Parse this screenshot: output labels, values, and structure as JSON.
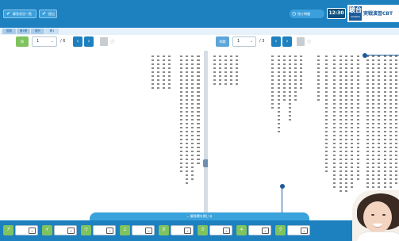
{
  "header": {
    "btn_exit": "解答状況一覧",
    "btn_submit": "提出",
    "timer_label": "残り時間",
    "timer_value": "12:30",
    "logo_main": "駿台",
    "logo_sub": "SUNDAI",
    "brand": "実戦演習CBT"
  },
  "breadcrumbs": [
    "国語",
    "第1問",
    "現代",
    "問1"
  ],
  "left_doc": {
    "score": "問",
    "page": "1",
    "total": "/ 6"
  },
  "right_doc": {
    "score": "問題",
    "page": "1",
    "total": "/ 3"
  },
  "toggle_label": "解答欄を閉じる",
  "answers": [
    {
      "q": "ア"
    },
    {
      "q": "イ"
    },
    {
      "q": "ウ"
    },
    {
      "q": "エ"
    },
    {
      "q": "オ"
    },
    {
      "q": "カ"
    },
    {
      "q": "キ"
    },
    {
      "q": "ク"
    }
  ],
  "colors": {
    "header": "#1d80bf",
    "score_green": "#7ec35f",
    "score_blue": "#5ba5d9"
  }
}
